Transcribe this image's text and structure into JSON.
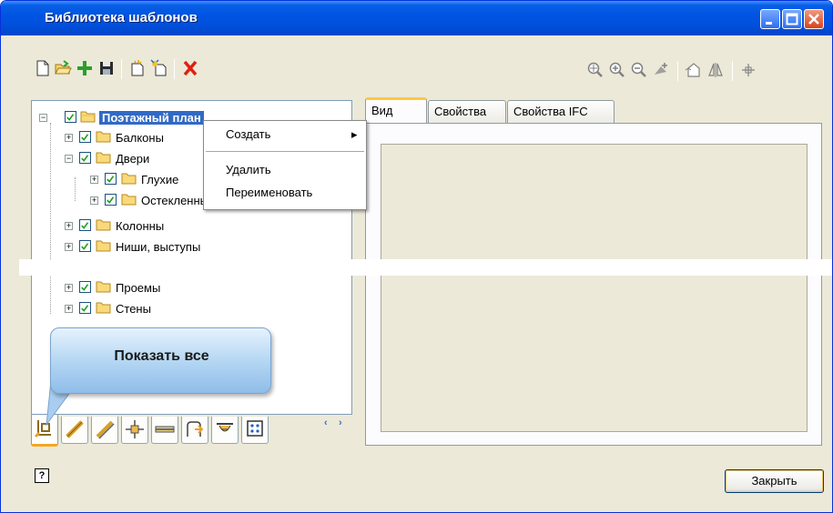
{
  "window": {
    "title": "Библиотека шаблонов"
  },
  "toolbar_left": [
    {
      "icon": "new-document-icon"
    },
    {
      "icon": "open-folder-icon"
    },
    {
      "icon": "add-plus-icon",
      "color": "#2aa02a"
    },
    {
      "icon": "save-icon"
    },
    {
      "icon": "new-template-icon"
    },
    {
      "icon": "sparkle-template-icon"
    },
    {
      "icon": "delete-x-icon",
      "color": "#e02010"
    }
  ],
  "toolbar_right": [
    {
      "icon": "zoom-extents-icon"
    },
    {
      "icon": "zoom-in-icon"
    },
    {
      "icon": "zoom-out-icon"
    },
    {
      "icon": "pan-icon"
    },
    {
      "icon": "view-3d-icon"
    },
    {
      "icon": "mirror-icon"
    },
    {
      "icon": "snap-crosshair-icon"
    }
  ],
  "tree": {
    "items": [
      {
        "label": "Поэтажный план",
        "selected": true,
        "expander": "−"
      },
      {
        "label": "Балконы",
        "expander": "+"
      },
      {
        "label": "Двери",
        "expander": "−"
      },
      {
        "label": "Глухие",
        "expander": "+"
      },
      {
        "label": "Остекленные",
        "expander": "+"
      },
      {
        "label": "Колонны",
        "expander": "+"
      },
      {
        "label": "Ниши, выступы",
        "expander": "+"
      },
      {
        "label": "Проемы",
        "expander": "+"
      },
      {
        "label": "Стены",
        "expander": "+"
      }
    ]
  },
  "context_menu": {
    "items": [
      {
        "label": "Создать",
        "submenu_arrow": "▸"
      },
      {
        "label": "Удалить"
      },
      {
        "label": "Переименовать"
      }
    ]
  },
  "callout": {
    "text": "Показать все"
  },
  "tabs": [
    {
      "label": "Вид",
      "active": true
    },
    {
      "label": "Свойства"
    },
    {
      "label": "Свойства IFC"
    }
  ],
  "bottom_tabs": [
    {
      "icon": "floor-plan-icon",
      "active": true
    },
    {
      "icon": "ruler-icon"
    },
    {
      "icon": "measure-icon"
    },
    {
      "icon": "column-node-icon"
    },
    {
      "icon": "beam-icon"
    },
    {
      "icon": "stair-profile-icon"
    },
    {
      "icon": "ceiling-fixture-icon"
    },
    {
      "icon": "grid-dots-icon"
    }
  ],
  "bottom_scroll": {
    "left": "‹",
    "right": "›"
  },
  "footer": {
    "help_label": "?",
    "close_label": "Закрыть"
  }
}
